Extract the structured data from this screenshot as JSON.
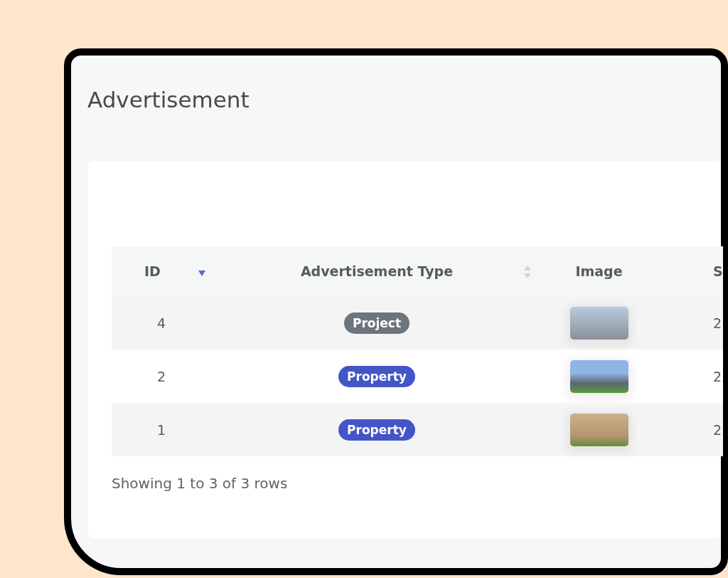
{
  "page": {
    "title": "Advertisement"
  },
  "table": {
    "columns": [
      {
        "label": "ID",
        "sorted": true
      },
      {
        "label": "Advertisement Type",
        "sorted": false
      },
      {
        "label": "Image"
      },
      {
        "label": "S"
      }
    ],
    "rows": [
      {
        "id": "4",
        "type": {
          "label": "Project",
          "kind": "project"
        },
        "column_4": "2"
      },
      {
        "id": "2",
        "type": {
          "label": "Property",
          "kind": "property"
        },
        "column_4": "2"
      },
      {
        "id": "1",
        "type": {
          "label": "Property",
          "kind": "property"
        },
        "column_4": "2"
      }
    ]
  },
  "footer": {
    "summary": "Showing 1 to 3 of 3 rows"
  }
}
